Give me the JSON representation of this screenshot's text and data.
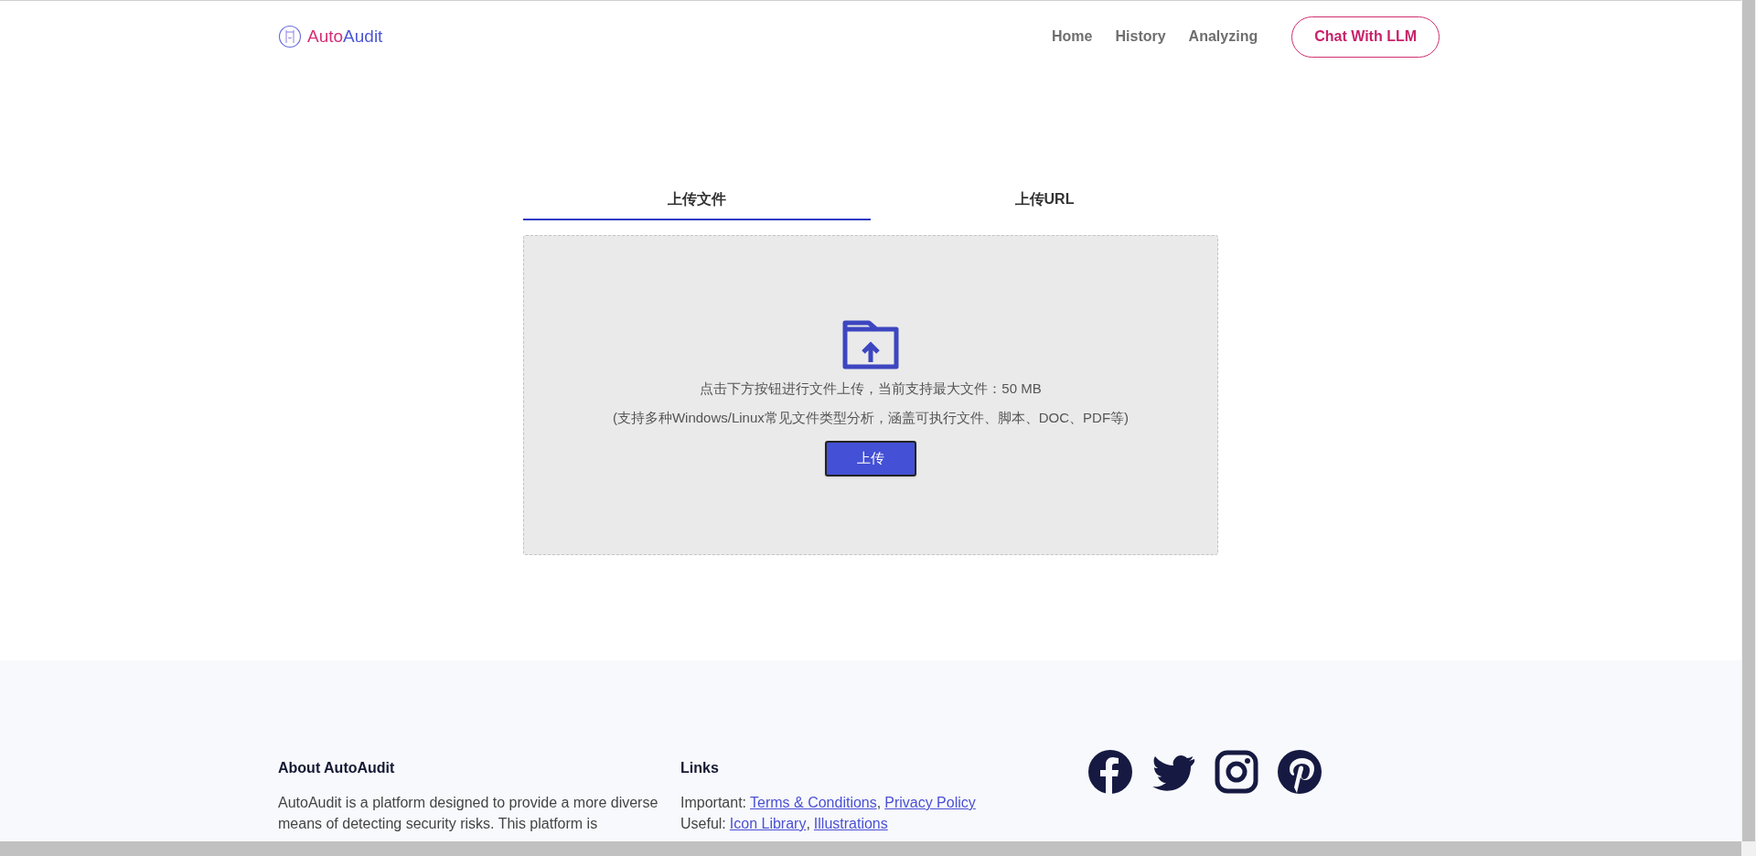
{
  "header": {
    "logo_parts": [
      "Auto",
      "Audit"
    ],
    "nav": [
      "Home",
      "History",
      "Analyzing"
    ],
    "cta": "Chat With LLM"
  },
  "tabs": [
    {
      "label": "上传文件",
      "selected": true
    },
    {
      "label": "上传URL",
      "selected": false
    }
  ],
  "upload": {
    "lines": [
      "点击下方按钮进行文件上传，当前支持最大文件：50 MB",
      "(支持多种Windows/Linux常见文件类型分析，涵盖可执行文件、脚本、DOC、PDF等)"
    ],
    "button": "上传"
  },
  "footer": {
    "about": {
      "title": "About AutoAudit",
      "text": "AutoAudit is a platform designed to provide a more diverse means of detecting security risks. This platform is"
    },
    "links": {
      "title": "Links",
      "rows": [
        {
          "label": "Important:",
          "links": [
            "Terms & Conditions",
            "Privacy Policy"
          ],
          "separator": ","
        },
        {
          "label": "Useful:",
          "links": [
            "Icon Library",
            "Illustrations"
          ],
          "separator": ","
        }
      ]
    },
    "social": [
      {
        "kind": "facebook"
      },
      {
        "kind": "twitter"
      },
      {
        "kind": "instagram"
      },
      {
        "kind": "pinterest"
      }
    ]
  }
}
